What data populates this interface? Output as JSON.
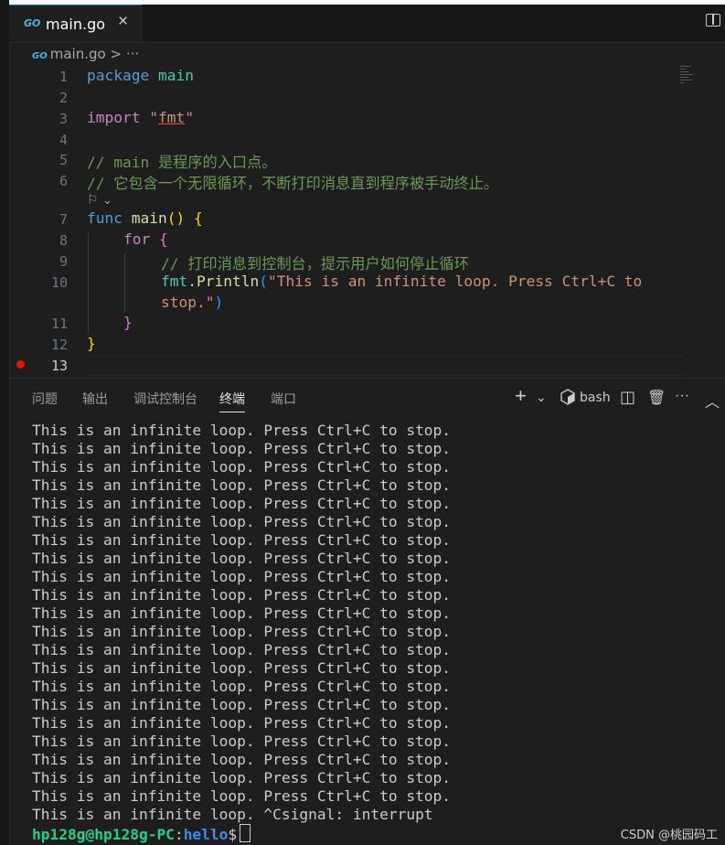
{
  "tab": {
    "icon": "go-file-icon",
    "icon_text": "GO",
    "title": "main.go",
    "close": "×"
  },
  "breadcrumb": {
    "file": "main.go",
    "sep": ">",
    "more": "···"
  },
  "editor": {
    "line_numbers": [
      "1",
      "2",
      "3",
      "4",
      "5",
      "6",
      "7",
      "8",
      "9",
      "10",
      "11",
      "12",
      "13"
    ],
    "codelens_glyph": "⚐",
    "codelens_chevron": "⌄",
    "lines": {
      "l1_kw": "package",
      "l1_name": " main",
      "l3_kw": "import",
      "l3_q1": " \"",
      "l3_pkg": "fmt",
      "l3_q2": "\"",
      "l5": "// main 是程序的入口点。",
      "l6": "// 它包含一个无限循环，不断打印消息直到程序被手动终止。",
      "l7_kw": "func",
      "l7_fn": " main",
      "l7_paren": "()",
      "l7_brace": " {",
      "l8_kw": "for",
      "l8_brace": " {",
      "l9": "// 打印消息到控制台，提示用户如何停止循环",
      "l10_pkg": "fmt",
      "l10_dot": ".",
      "l10_fn": "Println",
      "l10_paren": "(",
      "l10_str": "\"This is an infinite loop. Press Ctrl+C to",
      "l10b_str": "stop.\"",
      "l10b_paren": ")",
      "l11": "}",
      "l12": "}"
    }
  },
  "panel": {
    "tabs": [
      "问题",
      "输出",
      "调试控制台",
      "终端",
      "端口"
    ],
    "active_tab": "终端",
    "tools": {
      "add": "+",
      "dropdown": "⌄",
      "shell": "bash",
      "split": "◫",
      "trash": "🗑",
      "more": "···",
      "collapse": "︿"
    }
  },
  "terminal": {
    "lines": [
      "This is an infinite loop. Press Ctrl+C to stop.",
      "This is an infinite loop. Press Ctrl+C to stop.",
      "This is an infinite loop. Press Ctrl+C to stop.",
      "This is an infinite loop. Press Ctrl+C to stop.",
      "This is an infinite loop. Press Ctrl+C to stop.",
      "This is an infinite loop. Press Ctrl+C to stop.",
      "This is an infinite loop. Press Ctrl+C to stop.",
      "This is an infinite loop. Press Ctrl+C to stop.",
      "This is an infinite loop. Press Ctrl+C to stop.",
      "This is an infinite loop. Press Ctrl+C to stop.",
      "This is an infinite loop. Press Ctrl+C to stop.",
      "This is an infinite loop. Press Ctrl+C to stop.",
      "This is an infinite loop. Press Ctrl+C to stop.",
      "This is an infinite loop. Press Ctrl+C to stop.",
      "This is an infinite loop. Press Ctrl+C to stop.",
      "This is an infinite loop. Press Ctrl+C to stop.",
      "This is an infinite loop. Press Ctrl+C to stop.",
      "This is an infinite loop. Press Ctrl+C to stop.",
      "This is an infinite loop. Press Ctrl+C to stop.",
      "This is an infinite loop. Press Ctrl+C to stop.",
      "This is an infinite loop. Press Ctrl+C to stop.",
      "This is an infinite loop. ^Csignal: interrupt"
    ],
    "prompt_user": "hp128g@hp128g-PC",
    "prompt_colon": ":",
    "prompt_dir": "hello",
    "prompt_symbol": "$"
  },
  "watermark": "CSDN @桃园码工"
}
